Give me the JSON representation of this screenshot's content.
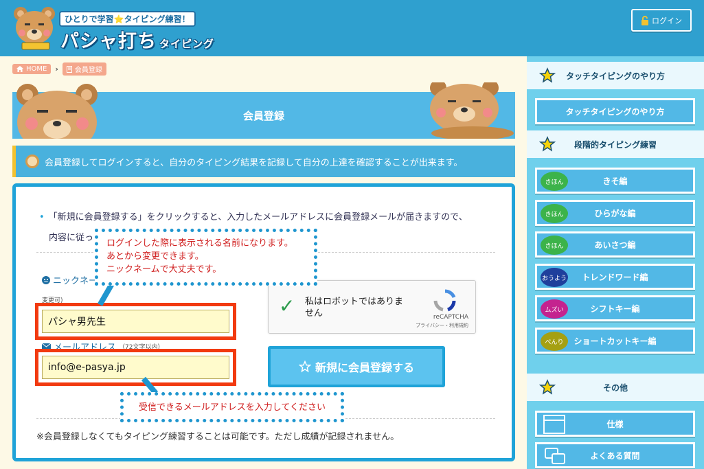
{
  "colors": {
    "header": "#2fa0cf",
    "accent": "#1fa3d8",
    "highlight": "#f23a10",
    "callout_text": "#d01f1f"
  },
  "header": {
    "tagline": "ひとりで学習⭐タイピング練習！",
    "title": "パシャ打ち",
    "title_sub": "タイピング",
    "login_label": "ログイン",
    "login_icon": "lock-icon"
  },
  "breadcrumb": [
    {
      "label": "HOME",
      "icon": "home-icon"
    },
    {
      "label": "会員登録",
      "icon": "document-icon"
    }
  ],
  "page": {
    "title": "会員登録",
    "info": "会員登録してログインすると、自分のタイピング結果を記録して自分の上達を確認することが出来ます。"
  },
  "form": {
    "note_line1": "「新規に会員登録する」をクリックすると、入力したメールアドレスに会員登録メールが届きますので、",
    "note_line2": "内容に従っ",
    "nickname_label": "ニックネー",
    "nickname_sub": "変更可)",
    "nickname_value": "パシャ男先生",
    "email_label": "メールアドレス",
    "email_sub": "（72文字以内）",
    "email_value": "info@e-pasya.jp",
    "captcha_text": "私はロボットではありません",
    "captcha_brand": "reCAPTCHA",
    "captcha_terms": "プライバシー・利用規約",
    "register_label": "新規に会員登録する",
    "footer_note": "※会員登録しなくてもタイピング練習することは可能です。ただし成績が記録されません。"
  },
  "callouts": {
    "nickname": [
      "ログインした際に表示される名前になります。",
      "あとから変更できます。",
      "ニックネームで大丈夫です。"
    ],
    "email": "受信できるメールアドレスを入力してください"
  },
  "sidebar": {
    "sections": [
      {
        "title": "タッチタイピングのやり方"
      },
      {
        "title": "段階的タイピング練習"
      },
      {
        "title": "その他"
      }
    ],
    "touch_button": "タッチタイピングのやり方",
    "levels": [
      {
        "badge": "きほん",
        "label": "きそ編",
        "color": "#3cb34a"
      },
      {
        "badge": "きほん",
        "label": "ひらがな編",
        "color": "#3cb34a"
      },
      {
        "badge": "きほん",
        "label": "あいさつ編",
        "color": "#3cb34a"
      },
      {
        "badge": "おうよう",
        "label": "トレンドワード編",
        "color": "#1f3f9c"
      },
      {
        "badge": "ムズい",
        "label": "シフトキー編",
        "color": "#c4238f"
      },
      {
        "badge": "べんり",
        "label": "ショートカットキー編",
        "color": "#a5a012"
      }
    ],
    "other": [
      {
        "label": "仕様",
        "icon": "spec-icon"
      },
      {
        "label": "よくある質問",
        "icon": "faq-icon"
      }
    ]
  }
}
